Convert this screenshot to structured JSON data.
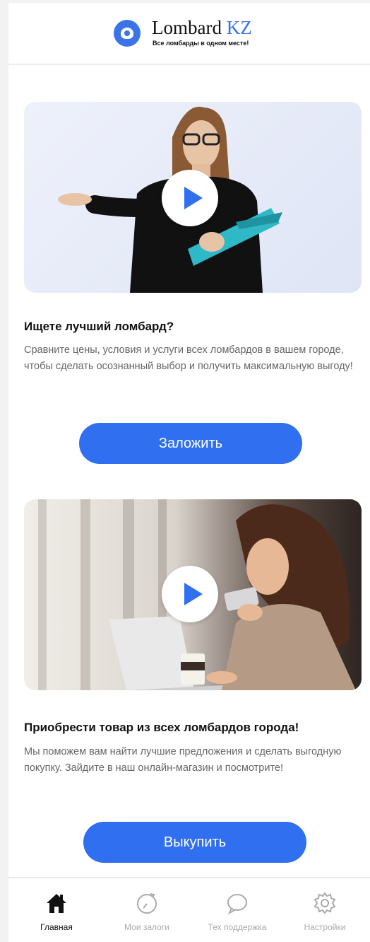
{
  "header": {
    "brand_main": "Lombard",
    "brand_accent": "KZ",
    "tagline": "Все ломбарды в одном месте!"
  },
  "sections": [
    {
      "title": "Ищете лучший ломбард?",
      "description": "Сравните цены, условия и услуги всех ломбардов в вашем городе, чтобы сделать осознанный выбор и получить максимальную выгоду!",
      "button": "Заложить"
    },
    {
      "title": "Приобрести товар из всех ломбардов города!",
      "description": "Мы поможем вам найти лучшие предложения и сделать выгодную покупку. Зайдите в наш онлайн-магазин и посмотрите!",
      "button": "Выкупить"
    }
  ],
  "tabs": [
    {
      "label": "Главная",
      "icon": "home-icon",
      "active": true
    },
    {
      "label": "Мои залоги",
      "icon": "timer-icon",
      "active": false
    },
    {
      "label": "Тех поддержка",
      "icon": "chat-bubble-icon",
      "active": false
    },
    {
      "label": "Настройки",
      "icon": "gear-icon",
      "active": false
    }
  ],
  "colors": {
    "accent": "#2f6ff0",
    "brand_blue": "#3a74e8",
    "inactive": "#aaaaaa"
  }
}
